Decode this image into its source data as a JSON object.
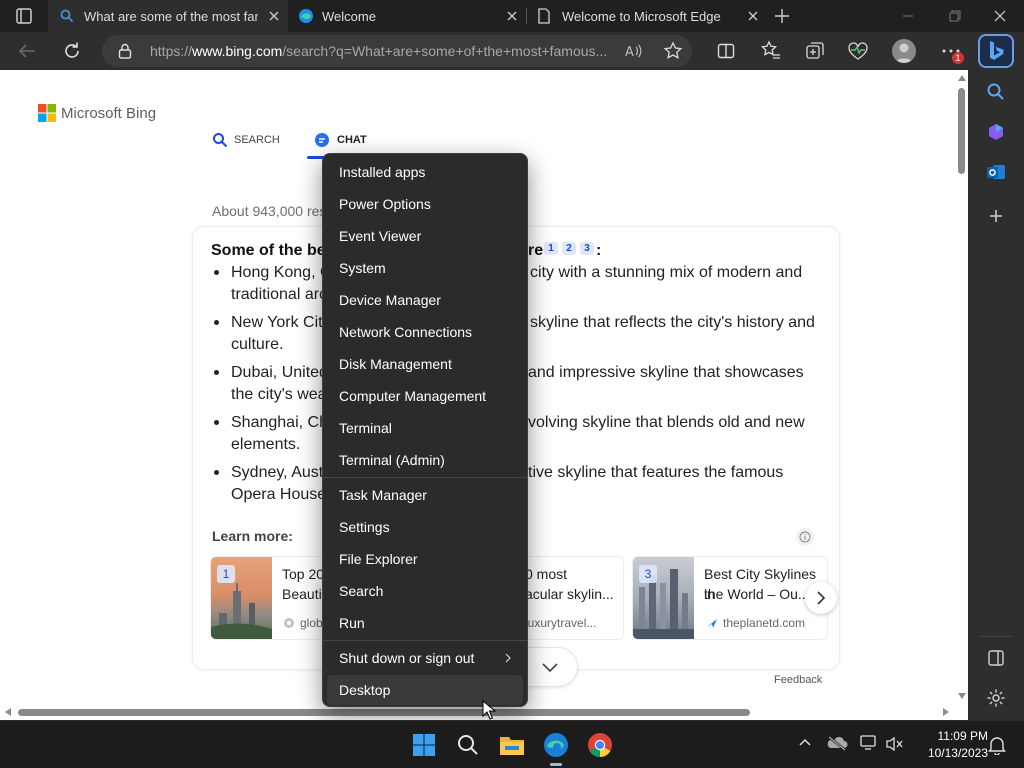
{
  "browser": {
    "tabs": [
      {
        "title": "What are some of the most famo",
        "active": true
      },
      {
        "title": "Welcome",
        "active": false
      },
      {
        "title": "Welcome to Microsoft Edge",
        "active": false
      }
    ],
    "url_prefix": "https://",
    "url_host": "www.bing.com",
    "url_rest": "/search?q=What+are+some+of+the+most+famous...",
    "profile_badge": "1"
  },
  "bing": {
    "brand": "Microsoft Bing",
    "nav": {
      "search": "SEARCH",
      "chat": "CHAT"
    },
    "results_count": "About 943,000 res",
    "heading_start": "Some of the bes",
    "heading_end": "re",
    "heading_colon": ":",
    "citations": [
      "1",
      "2",
      "3"
    ],
    "bullets": [
      {
        "left_line1": "Hong Kong, C",
        "right_line1": "city with a stunning mix of modern and",
        "line2": "traditional arc"
      },
      {
        "left_line1": "New York Cit",
        "right_line1": "skyline that reflects the city's history and",
        "line2": "culture."
      },
      {
        "left_line1": "Dubai, United",
        "right_line1": "and impressive skyline that showcases",
        "line2": "the city's wea"
      },
      {
        "left_line1": "Shanghai, Ch",
        "right_line1": "volving skyline that blends old and new",
        "line2": "elements."
      },
      {
        "left_line1": "Sydney, Austr",
        "right_line1": "tive skyline that features the famous",
        "line2": "Opera House"
      }
    ],
    "learn_more": "Learn more:",
    "cards": [
      {
        "num": "1",
        "title_line1": "Top 20",
        "title_line2": "Beautif",
        "source": "glob"
      },
      {
        "title_line1": "0 most",
        "title_line2": "acular skylin...",
        "source": "luxurytravel..."
      },
      {
        "num": "3",
        "title_line1": "Best City Skylines in",
        "title_line2": "the World – Ou...",
        "source": "theplanetd.com"
      }
    ],
    "feedback": "Feedback"
  },
  "context_menu": {
    "items": [
      {
        "label": "Installed apps"
      },
      {
        "label": "Power Options"
      },
      {
        "label": "Event Viewer"
      },
      {
        "label": "System"
      },
      {
        "label": "Device Manager"
      },
      {
        "label": "Network Connections"
      },
      {
        "label": "Disk Management"
      },
      {
        "label": "Computer Management"
      },
      {
        "label": "Terminal"
      },
      {
        "label": "Terminal (Admin)"
      },
      {
        "label": "Task Manager"
      },
      {
        "label": "Settings"
      },
      {
        "label": "File Explorer"
      },
      {
        "label": "Search"
      },
      {
        "label": "Run"
      },
      {
        "label": "Shut down or sign out",
        "submenu": true
      },
      {
        "label": "Desktop",
        "hovered": true
      }
    ]
  },
  "taskbar": {
    "time": "11:09 PM",
    "date": "10/13/2023"
  },
  "colors": {
    "bing_accent": "#174ae4",
    "menu_bg": "#2b2b2b",
    "menu_hover": "#3a3a3a"
  }
}
